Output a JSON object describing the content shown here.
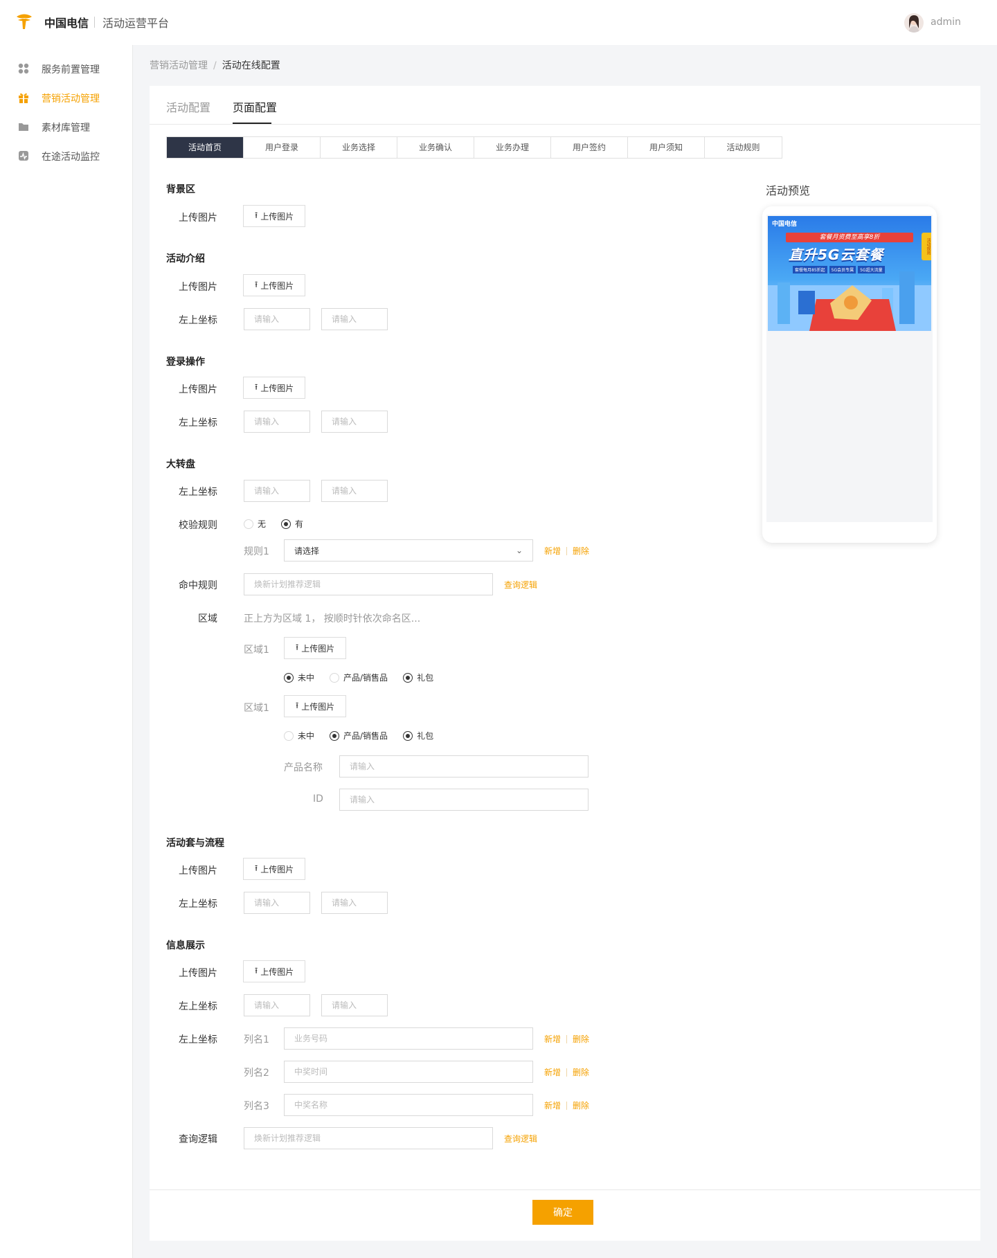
{
  "header": {
    "brand": "中国电信",
    "platform": "活动运营平台",
    "username": "admin"
  },
  "sidebar": {
    "items": [
      {
        "label": "服务前置管理",
        "icon": "grid-icon",
        "active": false
      },
      {
        "label": "营销活动管理",
        "icon": "gift-icon",
        "active": true
      },
      {
        "label": "素材库管理",
        "icon": "folder-icon",
        "active": false
      },
      {
        "label": "在途活动监控",
        "icon": "monitor-icon",
        "active": false
      }
    ]
  },
  "breadcrumb": {
    "parent": "营销活动管理",
    "separator": "/",
    "current": "活动在线配置"
  },
  "main_tabs": [
    {
      "label": "活动配置",
      "active": false
    },
    {
      "label": "页面配置",
      "active": true
    }
  ],
  "sub_tabs": [
    {
      "label": "活动首页",
      "active": true
    },
    {
      "label": "用户登录",
      "active": false
    },
    {
      "label": "业务选择",
      "active": false
    },
    {
      "label": "业务确认",
      "active": false
    },
    {
      "label": "业务办理",
      "active": false
    },
    {
      "label": "用户签约",
      "active": false
    },
    {
      "label": "用户须知",
      "active": false
    },
    {
      "label": "活动规则",
      "active": false
    }
  ],
  "common": {
    "upload_label": "上传图片",
    "coord_label": "左上坐标",
    "input_placeholder": "请输入",
    "add": "新增",
    "delete": "删除",
    "query_logic": "查询逻辑"
  },
  "sections": {
    "background": {
      "title": "背景区"
    },
    "intro": {
      "title": "活动介绍"
    },
    "login": {
      "title": "登录操作"
    },
    "wheel": {
      "title": "大转盘",
      "validation_label": "校验规则",
      "validation_options": [
        "无",
        "有"
      ],
      "validation_selected": "有",
      "rule_label": "规则1",
      "rule_placeholder": "请选择",
      "hit_rule_label": "命中规则",
      "hit_rule_placeholder": "焕新计划推荐逻辑",
      "region_label": "区域",
      "region_hint": "正上方为区域 1， 按顺时针依次命名区...",
      "regions": [
        {
          "label": "区域1",
          "options": [
            "未中",
            "产品/销售品",
            "礼包"
          ]
        },
        {
          "label": "区域1",
          "options": [
            "未中",
            "产品/销售品",
            "礼包"
          ]
        }
      ],
      "product_name_label": "产品名称",
      "id_label": "ID"
    },
    "flow": {
      "title": "活动套与流程"
    },
    "info": {
      "title": "信息展示",
      "columns_label": "左上坐标",
      "columns": [
        {
          "label": "列名1",
          "placeholder": "业务号码"
        },
        {
          "label": "列名2",
          "placeholder": "中奖时间"
        },
        {
          "label": "列名3",
          "placeholder": "中奖名称"
        }
      ],
      "query_label": "查询逻辑",
      "query_placeholder": "焕新计划推荐逻辑"
    }
  },
  "preview": {
    "title": "活动预览",
    "banner": {
      "logo_text": "中国电信",
      "headline": "套餐月资费至高享8折",
      "title": "直升5G云套餐",
      "tags": [
        "套餐每月85折起",
        "5G会员专属",
        "5G超大流量"
      ],
      "side_badge": "活动规则"
    }
  },
  "footer": {
    "confirm": "确定"
  },
  "colors": {
    "accent": "#f5a100",
    "active_tab_bg": "#2e3547"
  }
}
